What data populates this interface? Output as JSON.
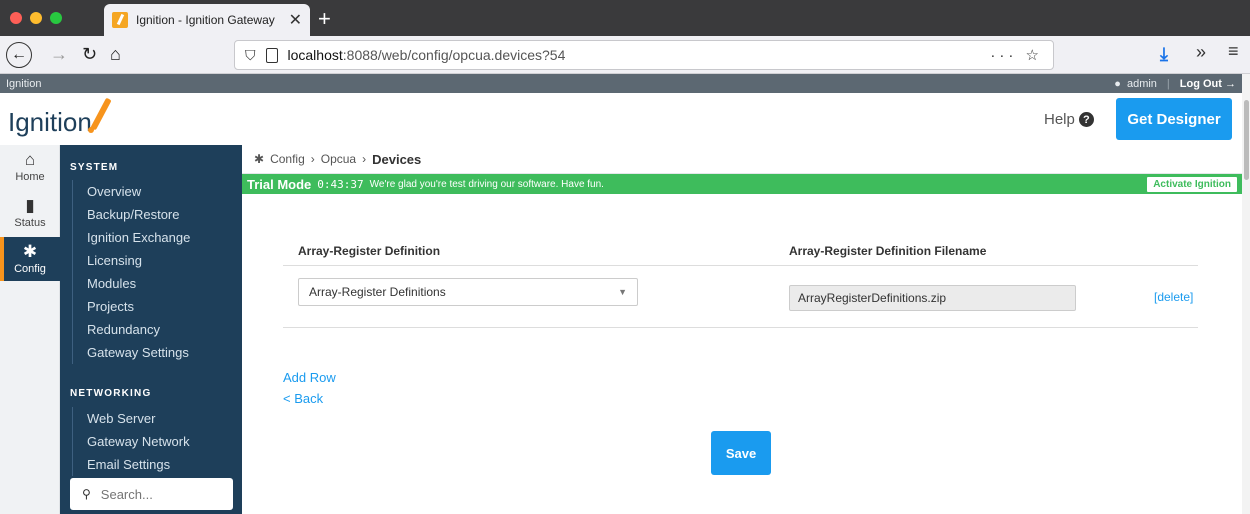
{
  "browser": {
    "tab_title": "Ignition - Ignition Gateway",
    "tab_close": "✕",
    "new_tab": "+",
    "url_host": "localhost",
    "url_path": ":8088/web/config/opcua.devices?54",
    "url_actions": "··· ☆",
    "icons": {
      "back": "←",
      "forward": "→",
      "reload": "↻",
      "home": "⌂",
      "download": "⤓",
      "more": "»",
      "menu": "≡",
      "shield": "⛉"
    }
  },
  "app": {
    "strip_title": "Ignition",
    "user": "admin",
    "logout": "Log Out →",
    "logo_text": "Ignition",
    "help": "Help",
    "help_icon": "?",
    "get_designer": "Get Designer"
  },
  "iconnav": {
    "home": "Home",
    "status": "Status",
    "config": "Config"
  },
  "sidebar": {
    "system_title": "SYSTEM",
    "system_items": [
      "Overview",
      "Backup/Restore",
      "Ignition Exchange",
      "Licensing",
      "Modules",
      "Projects",
      "Redundancy",
      "Gateway Settings"
    ],
    "networking_title": "NETWORKING",
    "networking_items": [
      "Web Server",
      "Gateway Network",
      "Email Settings"
    ],
    "search_placeholder": "Search..."
  },
  "breadcrumb": {
    "config": "Config",
    "opcua": "Opcua",
    "current": "Devices",
    "sep": "›"
  },
  "trial": {
    "mode": "Trial Mode",
    "timer": "0:43:37",
    "message": "We're glad you're test driving our software. Have fun.",
    "activate": "Activate Ignition"
  },
  "form": {
    "col1_header": "Array-Register Definition",
    "col2_header": "Array-Register Definition Filename",
    "select_value": "Array-Register Definitions",
    "filename_value": "ArrayRegisterDefinitions.zip",
    "delete": "[delete]",
    "add_row": "Add Row",
    "back": "< Back",
    "save": "Save"
  },
  "colors": {
    "nav_dark": "#1e3f5a",
    "accent_blue": "#1a9bef",
    "trial_green": "#3ebc5c",
    "logo_orange": "#f7941d"
  }
}
